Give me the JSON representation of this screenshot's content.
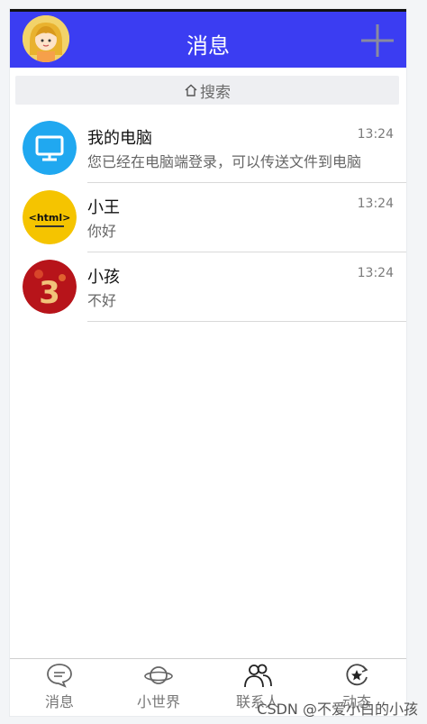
{
  "header": {
    "title": "消息",
    "avatar_icon": "girl-avatar-icon",
    "add_icon": "plus-icon",
    "bg_color": "#3b3df2"
  },
  "search": {
    "label": "搜索",
    "icon": "home-icon"
  },
  "conversations": [
    {
      "name": "我的电脑",
      "time": "13:24",
      "message": "您已经在电脑端登录，可以传送文件到电脑",
      "avatar_icon": "computer-monitor-icon",
      "avatar_color": "#20a8f0"
    },
    {
      "name": "小王",
      "time": "13:24",
      "message": "你好",
      "avatar_icon": "html-logo-icon",
      "avatar_color": "#f5c400",
      "avatar_text": "<html>"
    },
    {
      "name": "小孩",
      "time": "13:24",
      "message": "不好",
      "avatar_icon": "number-three-red-icon",
      "avatar_color": "#b7141a",
      "avatar_text": "3"
    }
  ],
  "tabs": [
    {
      "label": "消息",
      "icon": "chat-bubble-icon"
    },
    {
      "label": "小世界",
      "icon": "planet-icon"
    },
    {
      "label": "联系人",
      "icon": "contacts-icon"
    },
    {
      "label": "动态",
      "icon": "star-refresh-icon"
    }
  ],
  "watermark": "CSDN @不爱小白的小孩"
}
